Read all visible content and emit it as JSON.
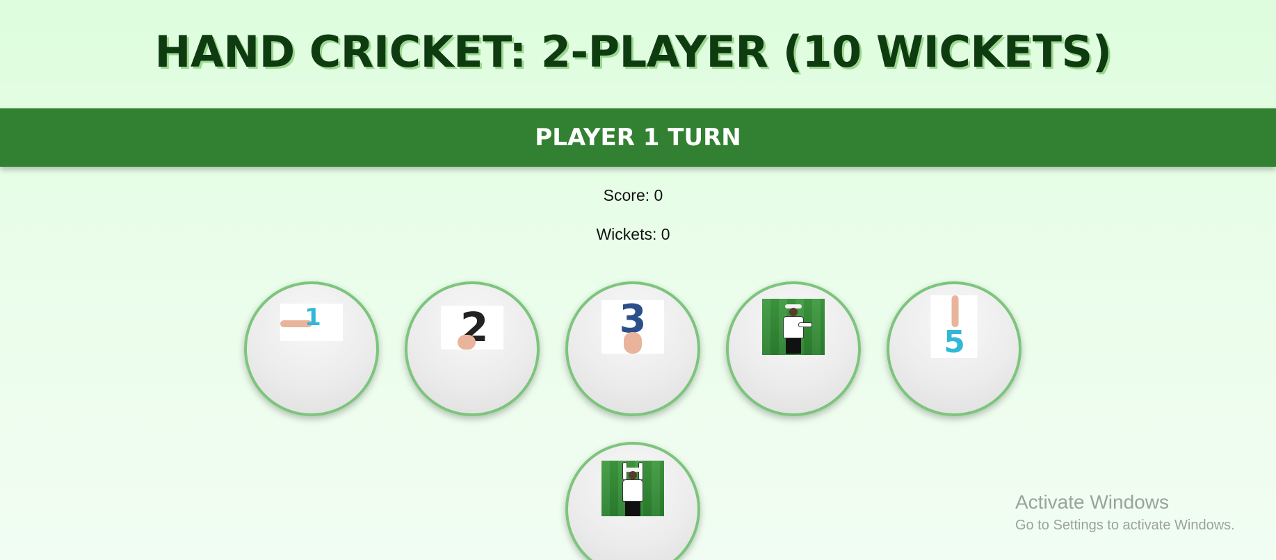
{
  "header": {
    "title": "HAND CRICKET: 2-PLAYER (10 WICKETS)"
  },
  "turn": {
    "label": "PLAYER 1 TURN"
  },
  "stats": {
    "score": "Score: 0",
    "wickets": "Wickets: 0"
  },
  "choices": [
    {
      "label": "1",
      "icon": "hand-number-1"
    },
    {
      "label": "2",
      "icon": "hand-number-2"
    },
    {
      "label": "3",
      "icon": "hand-number-3"
    },
    {
      "label": "4",
      "icon": "umpire-four-signal"
    },
    {
      "label": "5",
      "icon": "hand-number-5"
    },
    {
      "label": "6",
      "icon": "umpire-six-signal"
    }
  ],
  "watermark": {
    "title": "Activate Windows",
    "subtitle": "Go to Settings to activate Windows."
  },
  "colors": {
    "banner": "#328132",
    "title": "#0e3b10",
    "title_shadow": "#9bd88f",
    "circle_border": "#7cc57c",
    "number_cyan": "#31b7d8",
    "number_navy": "#2c4f8c"
  }
}
